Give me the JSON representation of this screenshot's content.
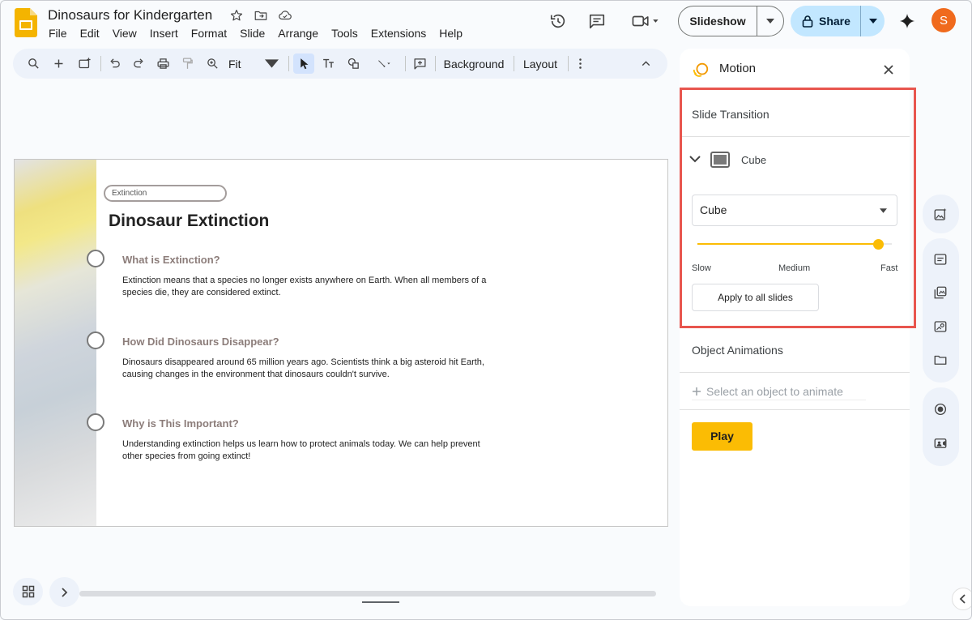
{
  "doc": {
    "title": "Dinosaurs for Kindergarten"
  },
  "menu": [
    "File",
    "Edit",
    "View",
    "Insert",
    "Format",
    "Slide",
    "Arrange",
    "Tools",
    "Extensions",
    "Help"
  ],
  "header": {
    "slideshow_label": "Slideshow",
    "share_label": "Share",
    "avatar_initial": "S"
  },
  "toolbar": {
    "zoom_label": "Fit",
    "background_label": "Background",
    "layout_label": "Layout"
  },
  "slide": {
    "tag": "Extinction",
    "title": "Dinosaur Extinction",
    "sections": [
      {
        "heading": "What is Extinction?",
        "body": "Extinction means that a species no longer exists anywhere on Earth. When all members of a species die, they are considered extinct."
      },
      {
        "heading": "How Did Dinosaurs Disappear?",
        "body": "Dinosaurs disappeared around 65 million years ago. Scientists think a big asteroid hit Earth, causing changes in the environment that dinosaurs couldn't survive."
      },
      {
        "heading": "Why is This Important?",
        "body": "Understanding extinction helps us learn how to protect animals today. We can help prevent other species from going extinct!"
      }
    ]
  },
  "motion": {
    "title": "Motion",
    "slide_transition_label": "Slide Transition",
    "transition_name": "Cube",
    "transition_select": "Cube",
    "speed_labels": {
      "slow": "Slow",
      "medium": "Medium",
      "fast": "Fast"
    },
    "speed_value": 0.93,
    "apply_label": "Apply to all slides",
    "object_animations_label": "Object Animations",
    "select_object_label": "Select an object to animate",
    "play_label": "Play"
  },
  "colors": {
    "accent": "#fbbc04",
    "highlight": "#e8554e",
    "share_bg": "#c2e7ff",
    "avatar": "#f06a1d"
  }
}
